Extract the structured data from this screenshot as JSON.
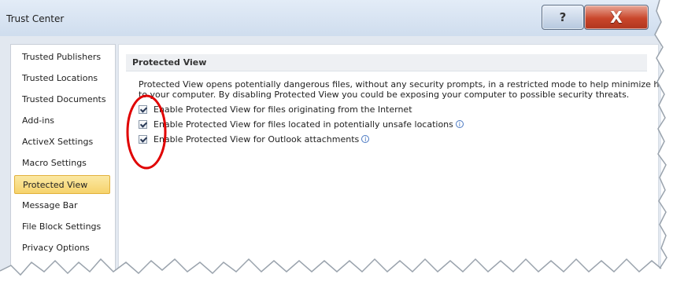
{
  "window": {
    "title": "Trust Center",
    "help_glyph": "?",
    "close_glyph": "X"
  },
  "sidebar": {
    "items": [
      {
        "label": "Trusted Publishers",
        "selected": false
      },
      {
        "label": "Trusted Locations",
        "selected": false
      },
      {
        "label": "Trusted Documents",
        "selected": false
      },
      {
        "label": "Add-ins",
        "selected": false
      },
      {
        "label": "ActiveX Settings",
        "selected": false
      },
      {
        "label": "Macro Settings",
        "selected": false
      },
      {
        "label": "Protected View",
        "selected": true
      },
      {
        "label": "Message Bar",
        "selected": false
      },
      {
        "label": "File Block Settings",
        "selected": false
      },
      {
        "label": "Privacy Options",
        "selected": false
      }
    ]
  },
  "main": {
    "section_title": "Protected View",
    "description_line1": "Protected View opens potentially dangerous files, without any security prompts, in a restricted mode to help minimize harm",
    "description_line2": "to your computer. By disabling Protected View you could be exposing your computer to possible security threats.",
    "options": [
      {
        "label": "Enable Protected View for files originating from the Internet",
        "checked": true,
        "info_icon": false
      },
      {
        "label": "Enable Protected View for files located in potentially unsafe locations",
        "checked": true,
        "info_icon": true
      },
      {
        "label": "Enable Protected View for Outlook attachments",
        "checked": true,
        "info_icon": true
      }
    ],
    "info_glyph": "i"
  },
  "colors": {
    "selected_item_bg": "#f6d36c",
    "annotation_circle": "#e00000",
    "close_button": "#c9462b"
  }
}
